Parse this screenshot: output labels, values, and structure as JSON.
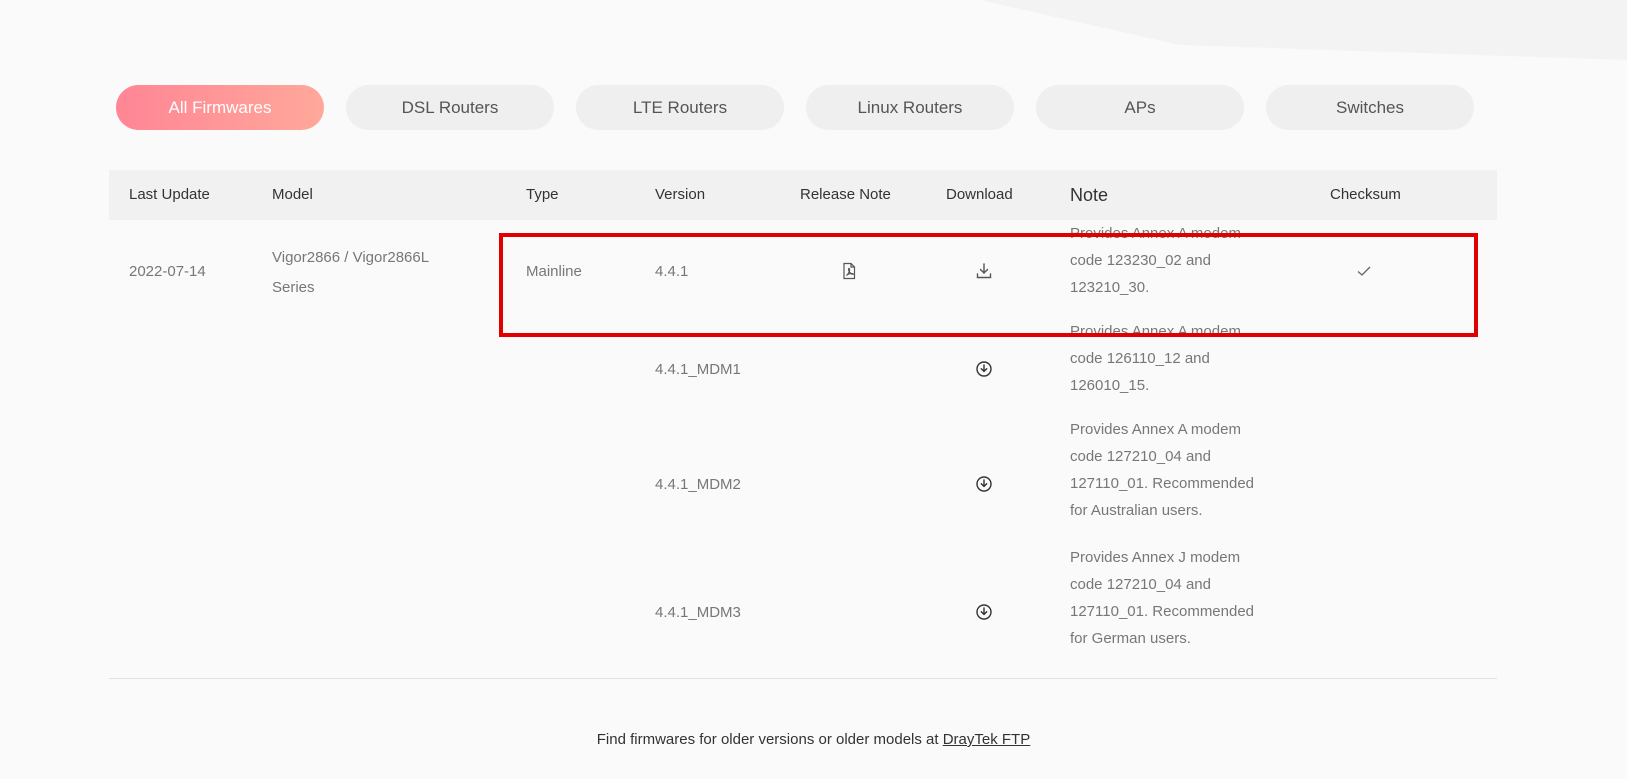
{
  "tabs": [
    {
      "label": "All Firmwares",
      "active": true
    },
    {
      "label": "DSL Routers",
      "active": false
    },
    {
      "label": "LTE Routers",
      "active": false
    },
    {
      "label": "Linux Routers",
      "active": false
    },
    {
      "label": "APs",
      "active": false
    },
    {
      "label": "Switches",
      "active": false
    }
  ],
  "table": {
    "headers": {
      "last_update": "Last Update",
      "model": "Model",
      "type": "Type",
      "version": "Version",
      "release_note": "Release Note",
      "download": "Download",
      "note": "Note",
      "checksum": "Checksum"
    },
    "entry": {
      "last_update": "2022-07-14",
      "model_line1": "Vigor2866 / Vigor2866L",
      "model_line2": "Series",
      "type": "Mainline"
    },
    "rows": [
      {
        "version": "4.4.1",
        "release_note_icon": "pdf-icon",
        "download_icon": "download-tray-icon",
        "checksum_icon": "checkmark-icon",
        "note": "Provides Annex A modem code 123230_02 and 123210_30."
      },
      {
        "version": "4.4.1_MDM1",
        "download_icon": "download-circle-icon",
        "note": "Provides Annex A modem code 126110_12 and 126010_15."
      },
      {
        "version": "4.4.1_MDM2",
        "download_icon": "download-circle-icon",
        "note": "Provides Annex A modem code 127210_04 and 127110_01. Recommended for Australian users."
      },
      {
        "version": "4.4.1_MDM3",
        "download_icon": "download-circle-icon",
        "note": "Provides Annex J modem code 127210_04 and 127110_01. Recommended for German users."
      }
    ]
  },
  "footer": {
    "text": "Find firmwares for older versions or older models at ",
    "link": "DrayTek FTP"
  },
  "colors": {
    "active_tab_start": "#ff8595",
    "active_tab_end": "#ffa89a",
    "highlight_border": "#e00000"
  }
}
